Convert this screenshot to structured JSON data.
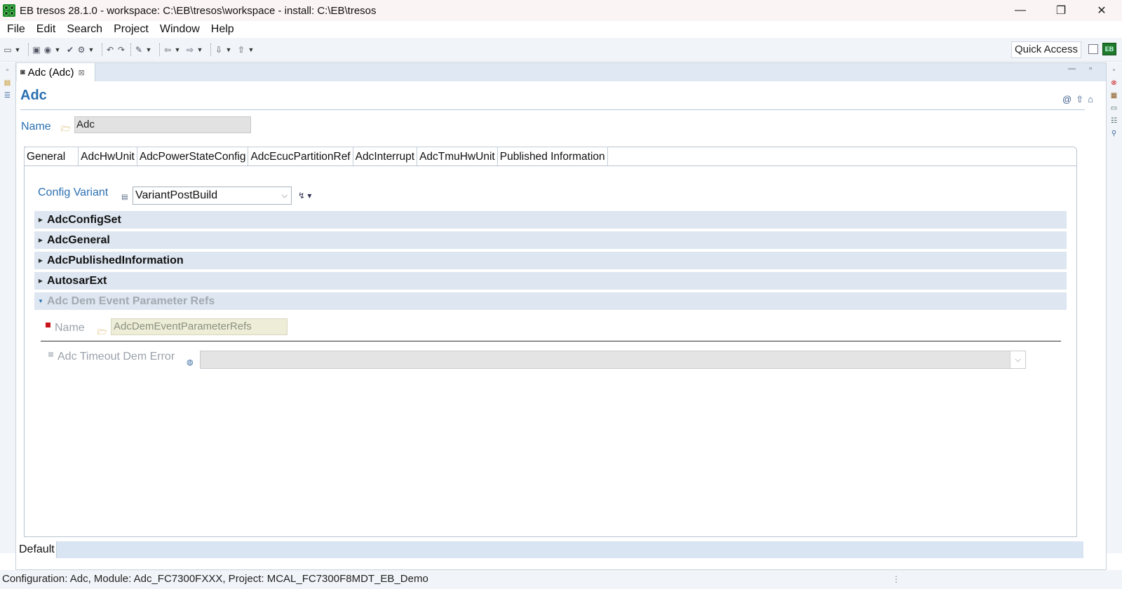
{
  "window": {
    "title": "EB tresos 28.1.0 - workspace: C:\\EB\\tresos\\workspace - install: C:\\EB\\tresos",
    "controls": {
      "minimize": "—",
      "restore": "❐",
      "close": "✕"
    }
  },
  "menu": [
    "File",
    "Edit",
    "Search",
    "Project",
    "Window",
    "Help"
  ],
  "toolbar": {
    "quick_access": "Quick Access"
  },
  "editor": {
    "tab_label": "Adc (Adc)",
    "tab_close": "⊠",
    "title": "Adc",
    "name_label": "Name",
    "name_value": "Adc",
    "tabs": [
      "General",
      "AdcHwUnit",
      "AdcPowerStateConfig",
      "AdcEcucPartitionRef",
      "AdcInterrupt",
      "AdcTmuHwUnit",
      "Published Information"
    ],
    "config_variant_label": "Config Variant",
    "config_variant_value": "VariantPostBuild",
    "sections": [
      {
        "label": "AdcConfigSet",
        "expanded": false,
        "enabled": true
      },
      {
        "label": "AdcGeneral",
        "expanded": false,
        "enabled": true
      },
      {
        "label": "AdcPublishedInformation",
        "expanded": false,
        "enabled": true
      },
      {
        "label": "AutosarExt",
        "expanded": false,
        "enabled": true
      },
      {
        "label": "Adc Dem Event Parameter Refs",
        "expanded": true,
        "enabled": false
      }
    ],
    "dem": {
      "name_label": "Name",
      "name_value": "AdcDemEventParameterRefs",
      "timeout_label": "Adc Timeout Dem Error",
      "timeout_value": ""
    },
    "bottom_tab": "Default"
  },
  "status": {
    "text": "Configuration: Adc, Module: Adc_FC7300FXXX, Project: MCAL_FC7300F8MDT_EB_Demo"
  },
  "colors": {
    "accent": "#2a6fb0",
    "section_bg": "#dde6f1",
    "required_marker": "#c8141a"
  }
}
